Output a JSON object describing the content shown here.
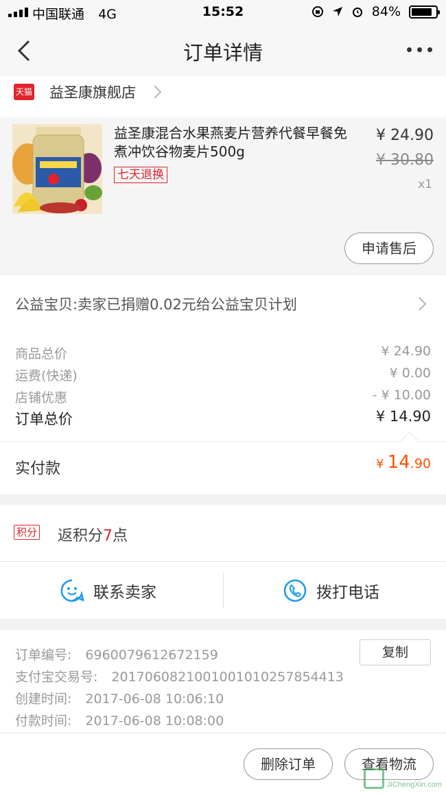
{
  "status_bar": {
    "carrier": "中国联通",
    "network": "4G",
    "time": "15:52",
    "battery": "84%",
    "battery_level": 0.84
  },
  "nav": {
    "title": "订单详情"
  },
  "shop": {
    "badge": "天猫",
    "name": "益圣康旗舰店"
  },
  "product": {
    "title": "益圣康混合水果燕麦片营养代餐早餐免煮冲饮谷物麦片500g",
    "tag": "七天退换",
    "price": "¥ 24.90",
    "original_price": "¥ 30.80",
    "quantity": "x1",
    "after_sale_button": "申请售后"
  },
  "charity": {
    "text": "公益宝贝:卖家已捐赠0.02元给公益宝贝计划"
  },
  "summary": {
    "rows": [
      {
        "label": "商品总价",
        "value": "¥ 24.90"
      },
      {
        "label": "运费(快递)",
        "value": "¥ 0.00"
      },
      {
        "label": "店铺优惠",
        "value": "- ¥ 10.00"
      }
    ],
    "total_label": "订单总价",
    "total_value": "¥ 14.90",
    "paid_label": "实付款",
    "paid_symbol": "¥",
    "paid_integer": "14",
    "paid_decimal": ".90"
  },
  "points": {
    "badge": "积分",
    "prefix": "返积分",
    "count": "7",
    "suffix": "点"
  },
  "contact": {
    "seller": "联系卖家",
    "phone": "拨打电话"
  },
  "order_info": {
    "order_no_label": "订单编号:",
    "order_no": "6960079612672159",
    "copy_button": "复制",
    "alipay_label": "支付宝交易号:",
    "alipay_no": "2017060821001001010257854413",
    "created_label": "创建时间:",
    "created": "2017-06-08 10:06:10",
    "paid_label": "付款时间:",
    "paid": "2017-06-08 10:08:00"
  },
  "bottom_bar": {
    "delete_button": "删除订单",
    "logistics_button": "查看物流"
  },
  "watermark": {
    "text": "JiChengXin.com"
  },
  "colors": {
    "accent": "#ff5000",
    "tmall_red": "#e0242c",
    "contact_blue": "#1e9be8"
  }
}
